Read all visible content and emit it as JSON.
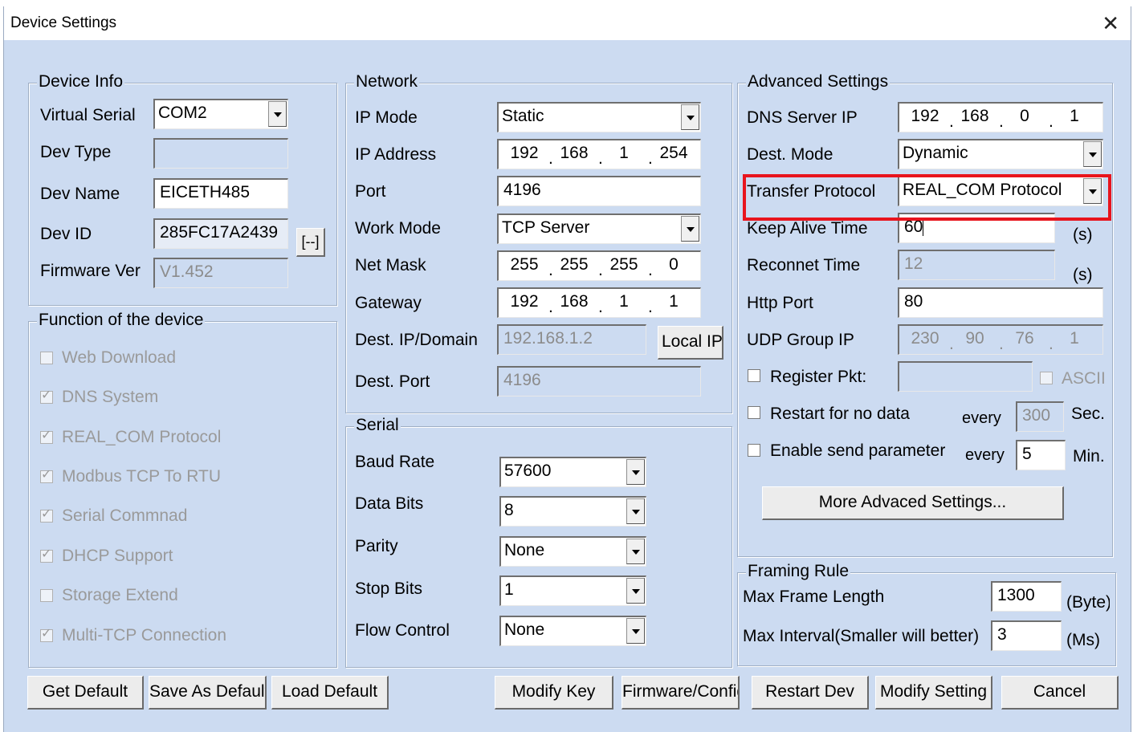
{
  "window": {
    "title": "Device Settings",
    "close_glyph": "✕"
  },
  "device_info": {
    "legend": "Device Info",
    "virtual_serial_label": "Virtual Serial",
    "virtual_serial": "COM2",
    "dev_type_label": "Dev Type",
    "dev_type": "",
    "dev_name_label": "Dev Name",
    "dev_name": "EICETH485",
    "dev_id_label": "Dev ID",
    "dev_id": "285FC17A2439",
    "dev_id_button": "[--]",
    "firmware_label": "Firmware Ver",
    "firmware": "V1.452"
  },
  "functions": {
    "legend": "Function of the device",
    "items": [
      {
        "label": "Web Download",
        "checked": false
      },
      {
        "label": "DNS System",
        "checked": true
      },
      {
        "label": "REAL_COM Protocol",
        "checked": true
      },
      {
        "label": "Modbus TCP To RTU",
        "checked": true
      },
      {
        "label": "Serial Commnad",
        "checked": true
      },
      {
        "label": "DHCP Support",
        "checked": true
      },
      {
        "label": "Storage Extend",
        "checked": false
      },
      {
        "label": "Multi-TCP Connection",
        "checked": true
      }
    ]
  },
  "network": {
    "legend": "Network",
    "ip_mode_label": "IP Mode",
    "ip_mode": "Static",
    "ip_address_label": "IP Address",
    "ip_address": [
      "192",
      "168",
      "1",
      "254"
    ],
    "port_label": "Port",
    "port": "4196",
    "work_mode_label": "Work Mode",
    "work_mode": "TCP Server",
    "net_mask_label": "Net Mask",
    "net_mask": [
      "255",
      "255",
      "255",
      "0"
    ],
    "gateway_label": "Gateway",
    "gateway": [
      "192",
      "168",
      "1",
      "1"
    ],
    "dest_ip_label": "Dest. IP/Domain",
    "dest_ip": "192.168.1.2",
    "local_ip_button": "Local IP",
    "dest_port_label": "Dest. Port",
    "dest_port": "4196"
  },
  "serial": {
    "legend": "Serial",
    "baud_rate_label": "Baud Rate",
    "baud_rate": "57600",
    "data_bits_label": "Data Bits",
    "data_bits": "8",
    "parity_label": "Parity",
    "parity": "None",
    "stop_bits_label": "Stop Bits",
    "stop_bits": "1",
    "flow_control_label": "Flow Control",
    "flow_control": "None"
  },
  "advanced": {
    "legend": "Advanced Settings",
    "dns_label": "DNS Server IP",
    "dns": [
      "192",
      "168",
      "0",
      "1"
    ],
    "dest_mode_label": "Dest. Mode",
    "dest_mode": "Dynamic",
    "transfer_protocol_label": "Transfer Protocol",
    "transfer_protocol": "REAL_COM Protocol",
    "keep_alive_label": "Keep Alive Time",
    "keep_alive": "60",
    "keep_alive_unit": "(s)",
    "reconnect_label": "Reconnet Time",
    "reconnect": "12",
    "reconnect_unit": "(s)",
    "http_port_label": "Http Port",
    "http_port": "80",
    "udp_group_label": "UDP Group IP",
    "udp_group": [
      "230",
      "90",
      "76",
      "1"
    ],
    "register_pkt_label": "Register Pkt:",
    "register_pkt": "",
    "ascii_label": "ASCII",
    "restart_label": "Restart for no data",
    "restart_every": "every",
    "restart_value": "300",
    "restart_unit": "Sec.",
    "enable_send_label": "Enable send parameter",
    "enable_every": "every",
    "enable_value": "5",
    "enable_unit": "Min.",
    "more_button": "More Advaced Settings..."
  },
  "framing": {
    "legend": "Framing Rule",
    "max_frame_label": "Max Frame Length",
    "max_frame": "1300",
    "max_frame_unit": "(Byte)",
    "max_interval_label": "Max Interval(Smaller will better)",
    "max_interval": "3",
    "max_interval_unit": "(Ms)"
  },
  "buttons": {
    "get_default": "Get Default",
    "save_default": "Save As Default",
    "load_default": "Load Default",
    "modify_key": "Modify Key",
    "firmware_config": "Firmware/Config",
    "restart_dev": "Restart Dev",
    "modify_setting": "Modify Setting",
    "cancel": "Cancel"
  },
  "colors": {
    "highlight": "#e8141d",
    "dialog_background": "#ccdbf1"
  }
}
